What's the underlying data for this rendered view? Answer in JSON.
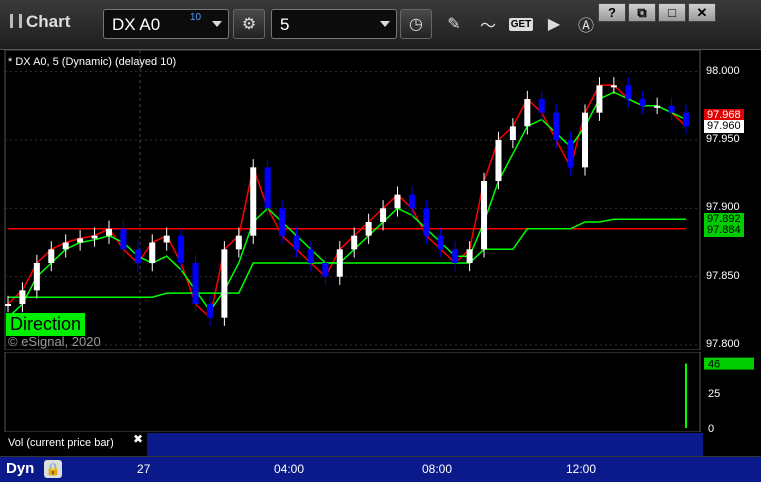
{
  "window": {
    "title": "Chart",
    "buttons": [
      "?",
      "⧉",
      "□",
      "✕"
    ]
  },
  "toolbar": {
    "symbol": "DX A0",
    "delay": "10",
    "interval": "5",
    "icons": [
      "settings-icon",
      "clock-icon",
      "pencil-icon",
      "study-icon",
      "get-icon",
      "play-icon",
      "alert-icon"
    ],
    "get_label": "GET"
  },
  "chart": {
    "caption": "* DX A0, 5 (Dynamic) (delayed 10)",
    "copyright": "© eSignal, 2020",
    "direction_label": "Direction",
    "price_tags": [
      {
        "label": "97.968",
        "bg": "#e00000",
        "fg": "#ffffff"
      },
      {
        "label": "97.960",
        "bg": "#ffffff",
        "fg": "#000000"
      },
      {
        "label": "97.892",
        "bg": "#00cc00",
        "fg": "#000000"
      },
      {
        "label": "97.884",
        "bg": "#00cc00",
        "fg": "#000000"
      }
    ],
    "y_ticks": [
      "98.000",
      "97.950",
      "97.900",
      "97.850",
      "97.800"
    ],
    "x_ticks": [
      "27",
      "04:00",
      "08:00",
      "12:00"
    ],
    "colors": {
      "up": "#ffffff",
      "down": "#0000ff",
      "red_line": "#ff0000",
      "green_line": "#00ff00",
      "background": "#000000"
    }
  },
  "chart_data": {
    "type": "line",
    "title": "",
    "ylim": [
      97.8,
      98.01
    ],
    "series": [
      {
        "values": [
          97.83,
          97.84,
          97.86,
          97.87,
          97.875,
          97.878,
          97.88,
          97.885,
          97.87,
          97.86,
          97.875,
          97.88,
          97.86,
          97.83,
          97.82,
          97.87,
          97.88,
          97.93,
          97.9,
          97.88,
          97.87,
          97.86,
          97.85,
          97.87,
          97.88,
          97.89,
          97.9,
          97.91,
          97.9,
          97.88,
          97.87,
          97.86,
          97.87,
          97.92,
          97.95,
          97.96,
          97.98,
          97.97,
          97.95,
          97.93,
          97.97,
          97.99,
          97.99,
          97.98,
          97.975,
          97.975,
          97.97,
          97.96
        ]
      },
      {
        "values": [
          97.885,
          97.885,
          97.885,
          97.885,
          97.885,
          97.885,
          97.885,
          97.885,
          97.885,
          97.885,
          97.885,
          97.885,
          97.885,
          97.885,
          97.885,
          97.885,
          97.885,
          97.885,
          97.885,
          97.885,
          97.885,
          97.885,
          97.885,
          97.885,
          97.885,
          97.885,
          97.885,
          97.885,
          97.885,
          97.885,
          97.885,
          97.885,
          97.885,
          97.885,
          97.885,
          97.885,
          97.885,
          97.885,
          97.885,
          97.885,
          97.885,
          97.885,
          97.885,
          97.885,
          97.885,
          97.885,
          97.885,
          97.885
        ]
      },
      {
        "values": [
          97.82,
          97.83,
          97.85,
          97.86,
          97.87,
          97.875,
          97.877,
          97.88,
          97.875,
          97.865,
          97.86,
          97.865,
          97.855,
          97.84,
          97.825,
          97.84,
          97.86,
          97.89,
          97.9,
          97.89,
          97.88,
          97.87,
          97.86,
          97.86,
          97.87,
          97.88,
          97.89,
          97.9,
          97.895,
          97.885,
          97.875,
          97.865,
          97.865,
          97.89,
          97.92,
          97.94,
          97.96,
          97.965,
          97.955,
          97.945,
          97.96,
          97.98,
          97.985,
          97.98,
          97.975,
          97.975,
          97.97,
          97.965
        ]
      },
      {
        "values": [
          97.835,
          97.835,
          97.835,
          97.835,
          97.835,
          97.835,
          97.835,
          97.835,
          97.835,
          97.835,
          97.835,
          97.838,
          97.838,
          97.838,
          97.838,
          97.838,
          97.838,
          97.86,
          97.86,
          97.86,
          97.86,
          97.86,
          97.86,
          97.86,
          97.86,
          97.86,
          97.86,
          97.86,
          97.86,
          97.86,
          97.86,
          97.86,
          97.86,
          97.87,
          97.87,
          97.87,
          97.885,
          97.885,
          97.885,
          97.885,
          97.89,
          97.89,
          97.892,
          97.892,
          97.892,
          97.892,
          97.892,
          97.892
        ]
      }
    ],
    "volume": {
      "ylim": [
        0,
        50
      ],
      "ticks": [
        "25",
        "0"
      ],
      "last_value": "46"
    }
  },
  "volume_panel": {
    "label": "Vol (current price bar)",
    "close": "✖"
  },
  "bottom": {
    "dyn_label": "Dyn"
  }
}
